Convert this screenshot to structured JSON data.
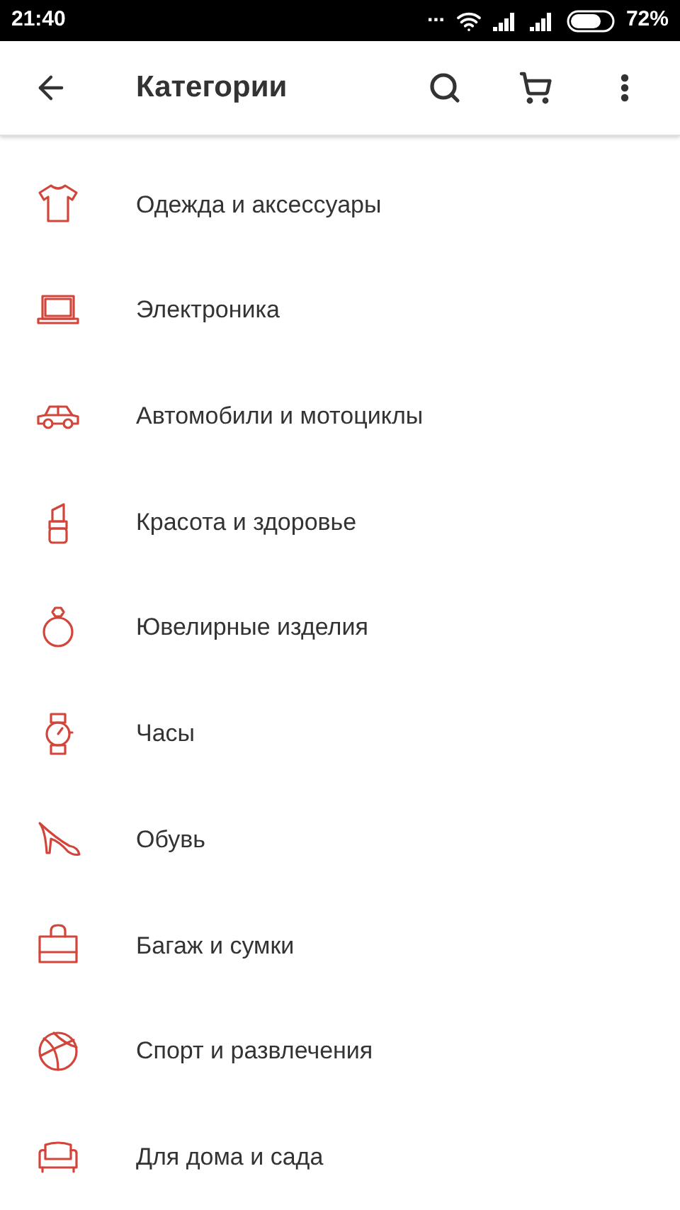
{
  "status_bar": {
    "time": "21:40",
    "dots": "...",
    "battery": "72%"
  },
  "app_bar": {
    "title": "Категории"
  },
  "categories": [
    {
      "kind": "shirt",
      "label": "Одежда и аксессуары"
    },
    {
      "kind": "laptop",
      "label": "Электроника"
    },
    {
      "kind": "car",
      "label": "Автомобили и мотоциклы"
    },
    {
      "kind": "lipstick",
      "label": "Красота и здоровье"
    },
    {
      "kind": "ring",
      "label": "Ювелирные изделия"
    },
    {
      "kind": "watch",
      "label": "Часы"
    },
    {
      "kind": "heel",
      "label": "Обувь"
    },
    {
      "kind": "bag",
      "label": "Багаж и сумки"
    },
    {
      "kind": "ball",
      "label": "Спорт и развлечения"
    },
    {
      "kind": "sofa",
      "label": "Для дома и сада"
    }
  ]
}
